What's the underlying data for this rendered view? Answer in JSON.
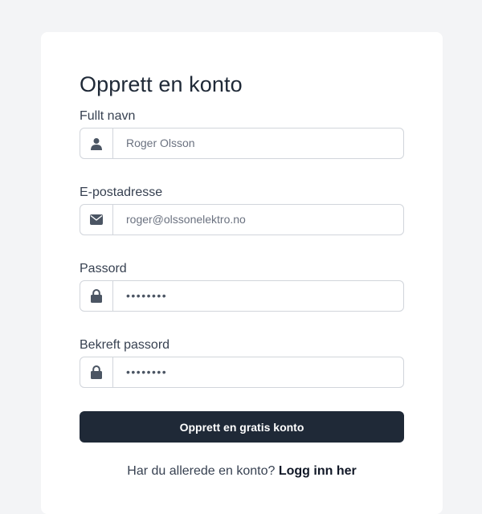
{
  "form": {
    "title": "Opprett en konto",
    "fields": [
      {
        "label": "Fullt navn",
        "value": "Roger Olsson",
        "icon": "user-icon",
        "type": "text"
      },
      {
        "label": "E-postadresse",
        "value": "roger@olssonelektro.no",
        "icon": "envelope-icon",
        "type": "email"
      },
      {
        "label": "Passord",
        "value": "••••••••",
        "icon": "lock-icon",
        "type": "password"
      },
      {
        "label": "Bekreft passord",
        "value": "••••••••",
        "icon": "lock-icon",
        "type": "password"
      }
    ],
    "submit_label": "Opprett en gratis konto",
    "footer_text": "Har du allerede en konto?",
    "login_link": "Logg inn her"
  },
  "colors": {
    "background": "#f3f4f6",
    "card": "#ffffff",
    "primary_button": "#1f2937",
    "border": "#d1d5db",
    "icon": "#4b5563"
  }
}
